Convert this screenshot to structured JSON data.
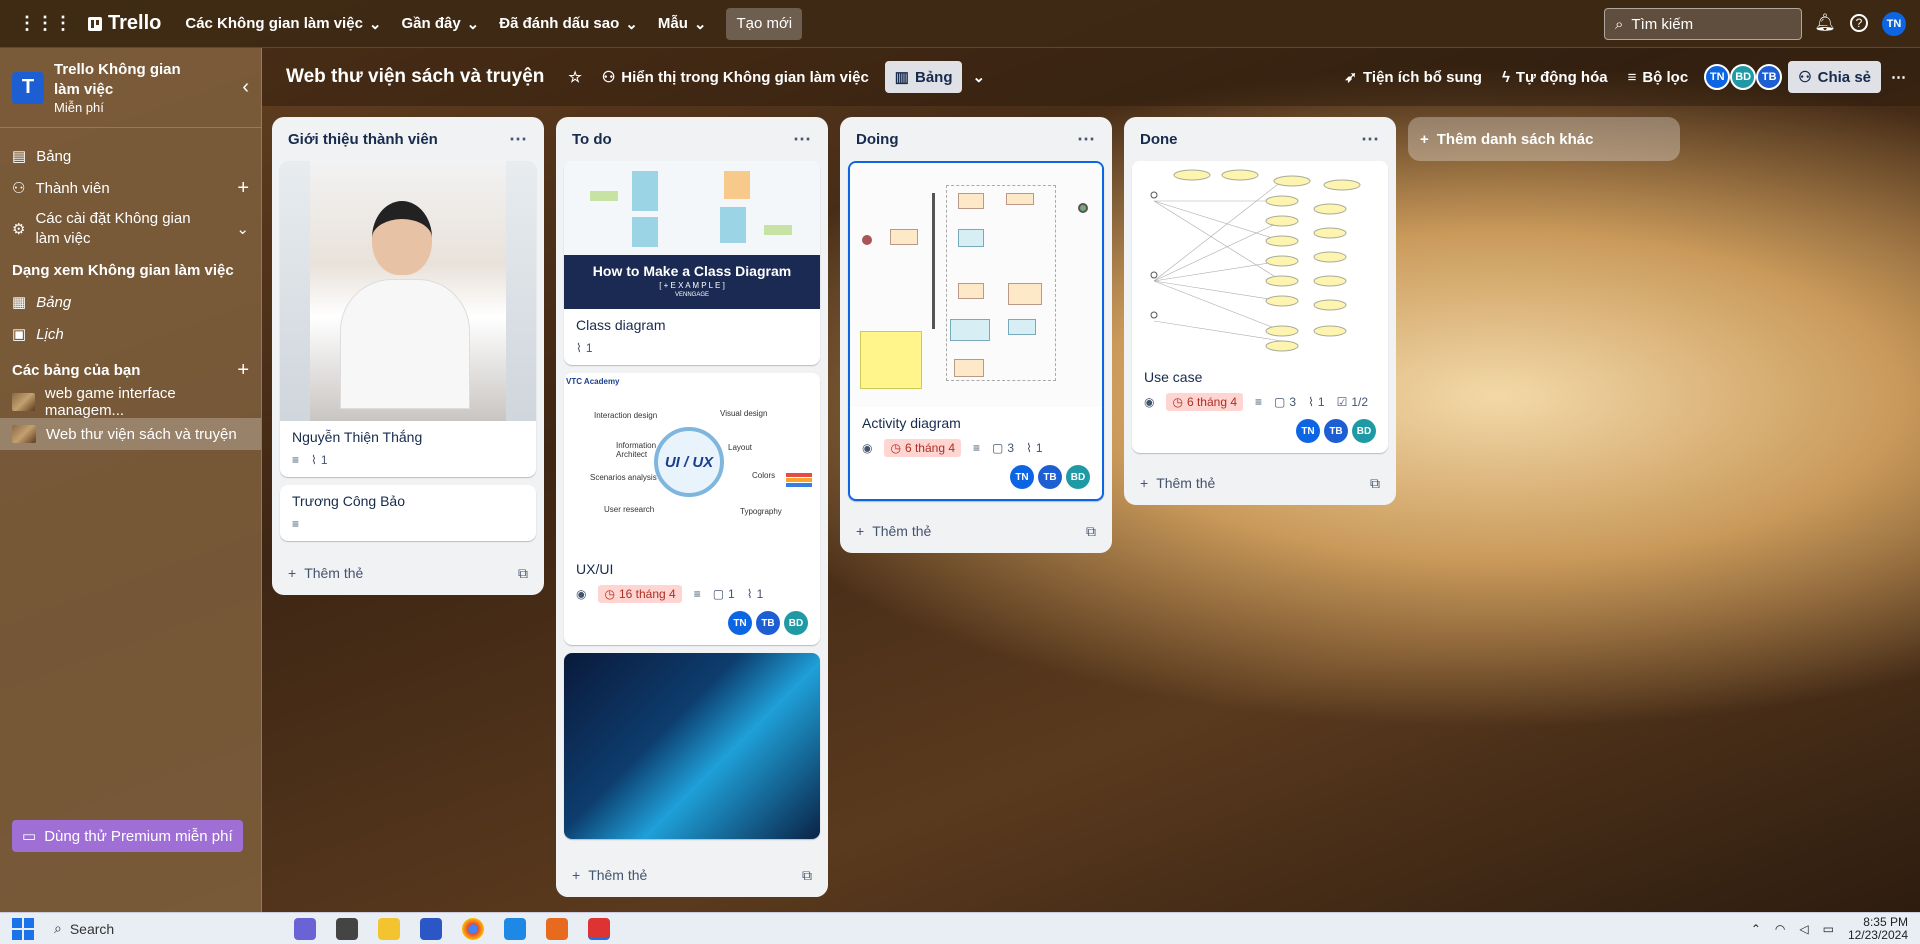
{
  "topbar": {
    "app_name": "Trello",
    "menus": [
      "Các Không gian làm việc",
      "Gần đây",
      "Đã đánh dấu sao",
      "Mẫu"
    ],
    "create_label": "Tạo mới",
    "search_placeholder": "Tìm kiếm",
    "user_initials": "TN"
  },
  "sidebar": {
    "workspace_name": "Trello Không gian làm việc",
    "workspace_letter": "T",
    "workspace_plan": "Miễn phí",
    "items": [
      {
        "label": "Bảng"
      },
      {
        "label": "Thành viên"
      },
      {
        "label": "Các cài đặt Không gian làm việc"
      }
    ],
    "views_heading": "Dạng xem Không gian làm việc",
    "views": [
      {
        "label": "Bảng"
      },
      {
        "label": "Lịch"
      }
    ],
    "boards_heading": "Các bảng của bạn",
    "boards": [
      {
        "label": "web game interface managem..."
      },
      {
        "label": "Web thư viện sách và truyện"
      }
    ],
    "premium_label": "Dùng thử Premium miễn phí"
  },
  "board": {
    "title": "Web thư viện sách và truyện",
    "visibility_label": "Hiển thị trong Không gian làm việc",
    "view_label": "Bảng",
    "powerups_label": "Tiện ích bổ sung",
    "automation_label": "Tự động hóa",
    "filter_label": "Bộ lọc",
    "members": [
      "TN",
      "BD",
      "TB"
    ],
    "share_label": "Chia sẻ",
    "add_list_label": "Thêm danh sách khác"
  },
  "lists": [
    {
      "title": "Giới thiệu thành viên",
      "cards": [
        {
          "title": "Nguyễn Thiện Thắng",
          "attachments": "1"
        },
        {
          "title": "Trương Công Bảo"
        }
      ],
      "add_card": "Thêm thẻ"
    },
    {
      "title": "To do",
      "cards": [
        {
          "cover_title": "How to Make a Class Diagram",
          "cover_sub": "[ + E X A M P L E ]",
          "cover_brand": "VENNGAGE",
          "title": "Class diagram",
          "attachments": "1"
        },
        {
          "cover_center": "UI / UX",
          "cover_brand": "VTC Academy",
          "cover_labels": [
            "Interaction design",
            "Information Architect",
            "Scenarios analysis",
            "User research",
            "Visual design",
            "Layout",
            "Colors",
            "Typography"
          ],
          "title": "UX/UI",
          "due": "16 tháng 4",
          "comments": "1",
          "attachments": "1",
          "members": [
            "TN",
            "TB",
            "BD"
          ]
        },
        {
          "title": ""
        }
      ],
      "add_card": "Thêm thẻ"
    },
    {
      "title": "Doing",
      "cards": [
        {
          "title": "Activity diagram",
          "due": "6 tháng 4",
          "comments": "3",
          "attachments": "1",
          "members": [
            "TN",
            "TB",
            "BD"
          ]
        }
      ],
      "add_card": "Thêm thẻ"
    },
    {
      "title": "Done",
      "cards": [
        {
          "title": "Use case",
          "due": "6 tháng 4",
          "comments": "3",
          "attachments": "1",
          "checklist": "1/2",
          "members": [
            "TN",
            "TB",
            "BD"
          ]
        }
      ],
      "add_card": "Thêm thẻ"
    }
  ],
  "taskbar": {
    "search_label": "Search",
    "time": "8:35 PM",
    "date": "12/23/2024"
  },
  "colors": {
    "tn": "#0c66e4",
    "tb": "#1d5fd3",
    "bd": "#1f9aa5",
    "due_bg": "#ffd5d2",
    "premium": "#a06fd6"
  }
}
